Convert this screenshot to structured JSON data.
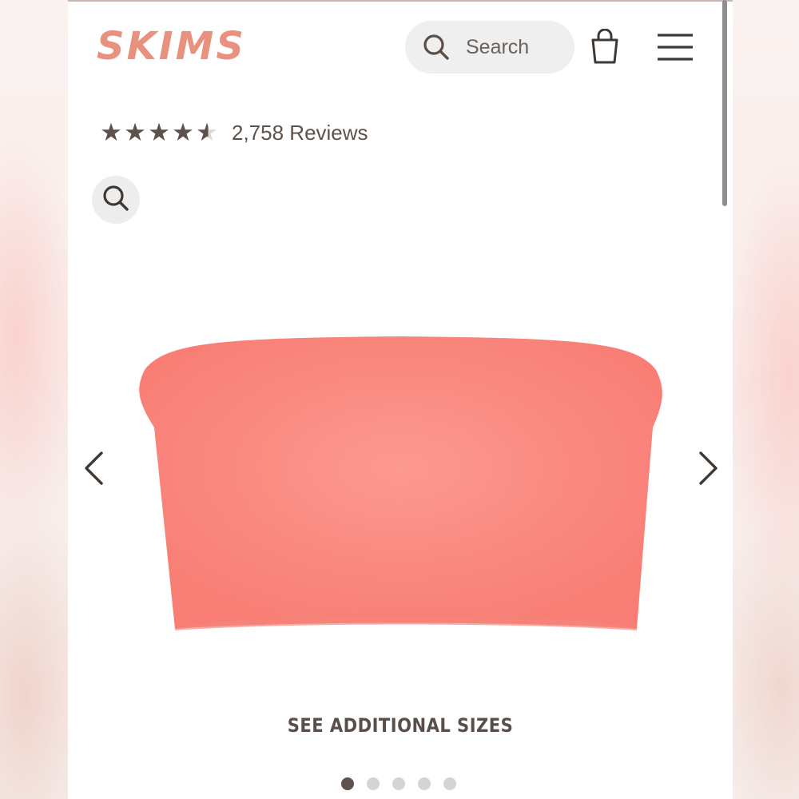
{
  "header": {
    "logo_text": "SKIMS",
    "search_placeholder": "Search",
    "icons": [
      "search-icon",
      "shopping-bag-icon",
      "hamburger-menu-icon"
    ]
  },
  "rating": {
    "stars_value": 4.5,
    "stars_max": 5,
    "review_count_text": "2,758 Reviews"
  },
  "gallery": {
    "zoom_icon": "search-icon",
    "product_color": "#f98a80",
    "prev_icon": "chevron-left-icon",
    "next_icon": "chevron-right-icon",
    "see_sizes_label": "SEE ADDITIONAL SIZES",
    "total_images": 5,
    "active_image_index": 0
  },
  "colors": {
    "brand": "#e8917f",
    "text": "#5d524b"
  }
}
